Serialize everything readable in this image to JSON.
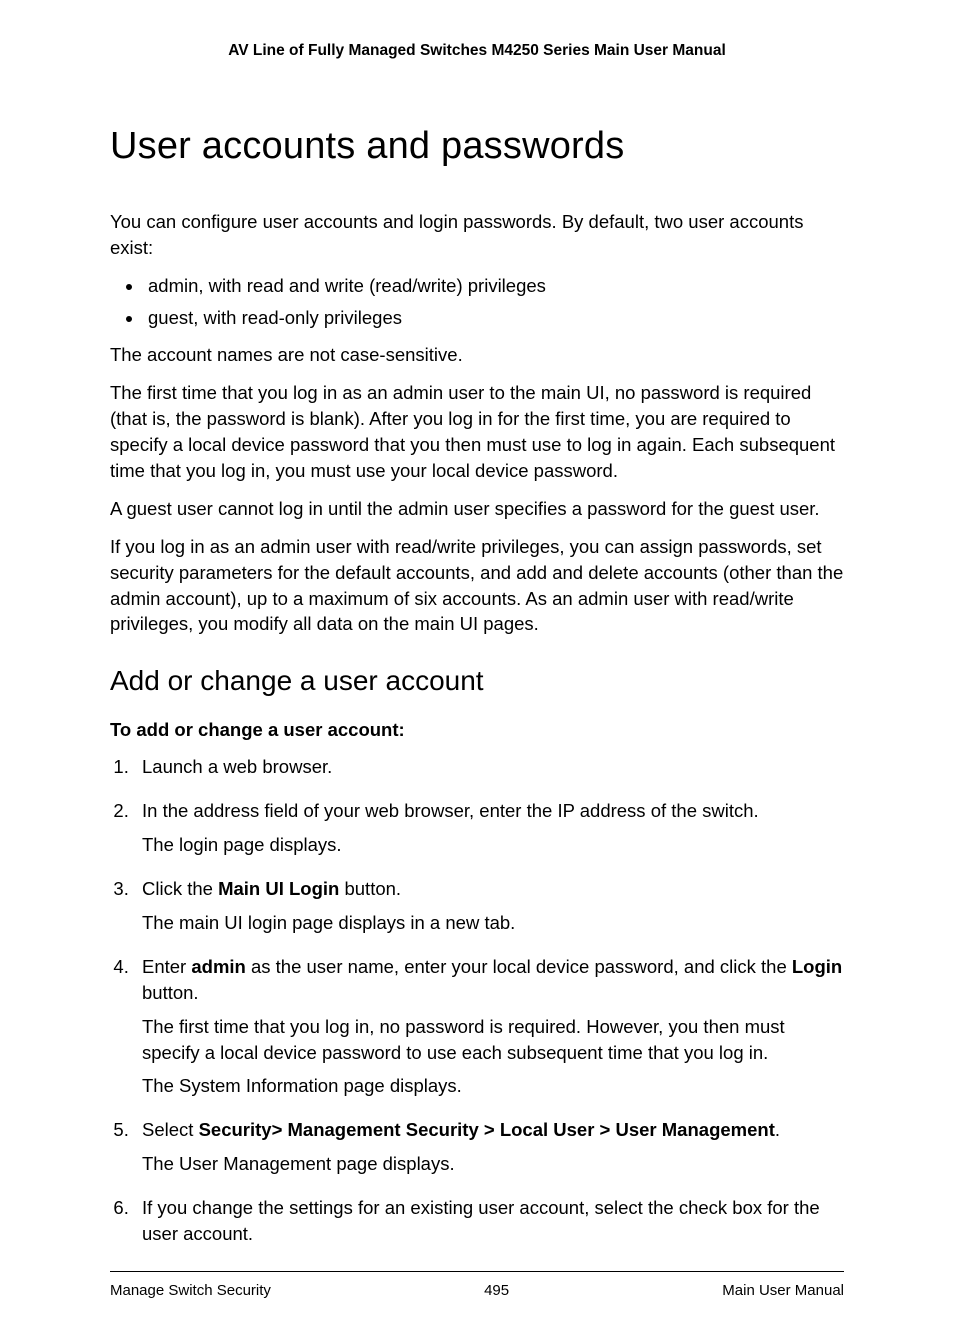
{
  "header": {
    "title": "AV Line of Fully Managed Switches M4250 Series Main User Manual"
  },
  "h1": "User accounts and passwords",
  "intro": "You can configure user accounts and login passwords. By default, two user accounts exist:",
  "bullets": [
    "admin, with read and write (read/write) privileges",
    "guest, with read-only privileges"
  ],
  "para1": "The account names are not case-sensitive.",
  "para2": "The first time that you log in as an admin user to the main UI, no password is required (that is, the password is blank). After you log in for the first time, you are required to specify a local device password that you then must use to log in again. Each subsequent time that you log in, you must use your local device password.",
  "para3": "A guest user cannot log in until the admin user specifies a password for the guest user.",
  "para4": "If you log in as an admin user with read/write privileges, you can assign passwords, set security parameters for the default accounts, and add and delete accounts (other than the admin account), up to a maximum of six accounts. As an admin user with read/write privileges, you modify all data on the main UI pages.",
  "h2": "Add or change a user account",
  "lead": "To add or change a user account:",
  "steps": {
    "s1": "Launch a web browser.",
    "s2a": "In the address field of your web browser, enter the IP address of the switch.",
    "s2b": "The login page displays.",
    "s3a_pre": "Click the ",
    "s3a_bold": "Main UI Login",
    "s3a_post": " button.",
    "s3b": "The main UI login page displays in a new tab.",
    "s4a_pre": "Enter ",
    "s4a_bold1": "admin",
    "s4a_mid": " as the user name, enter your local device password, and click the ",
    "s4a_bold2": "Login",
    "s4a_post": " button.",
    "s4b": "The first time that you log in, no password is required. However, you then must specify a local device password to use each subsequent time that you log in.",
    "s4c": "The System Information page displays.",
    "s5a_pre": "Select ",
    "s5a_bold": "Security> Management Security > Local User > User Management",
    "s5a_post": ".",
    "s5b": "The User Management page displays.",
    "s6": "If you change the settings for an existing user account, select the check box for the user account."
  },
  "footer": {
    "left": "Manage Switch Security",
    "center": "495",
    "right": "Main User Manual"
  }
}
